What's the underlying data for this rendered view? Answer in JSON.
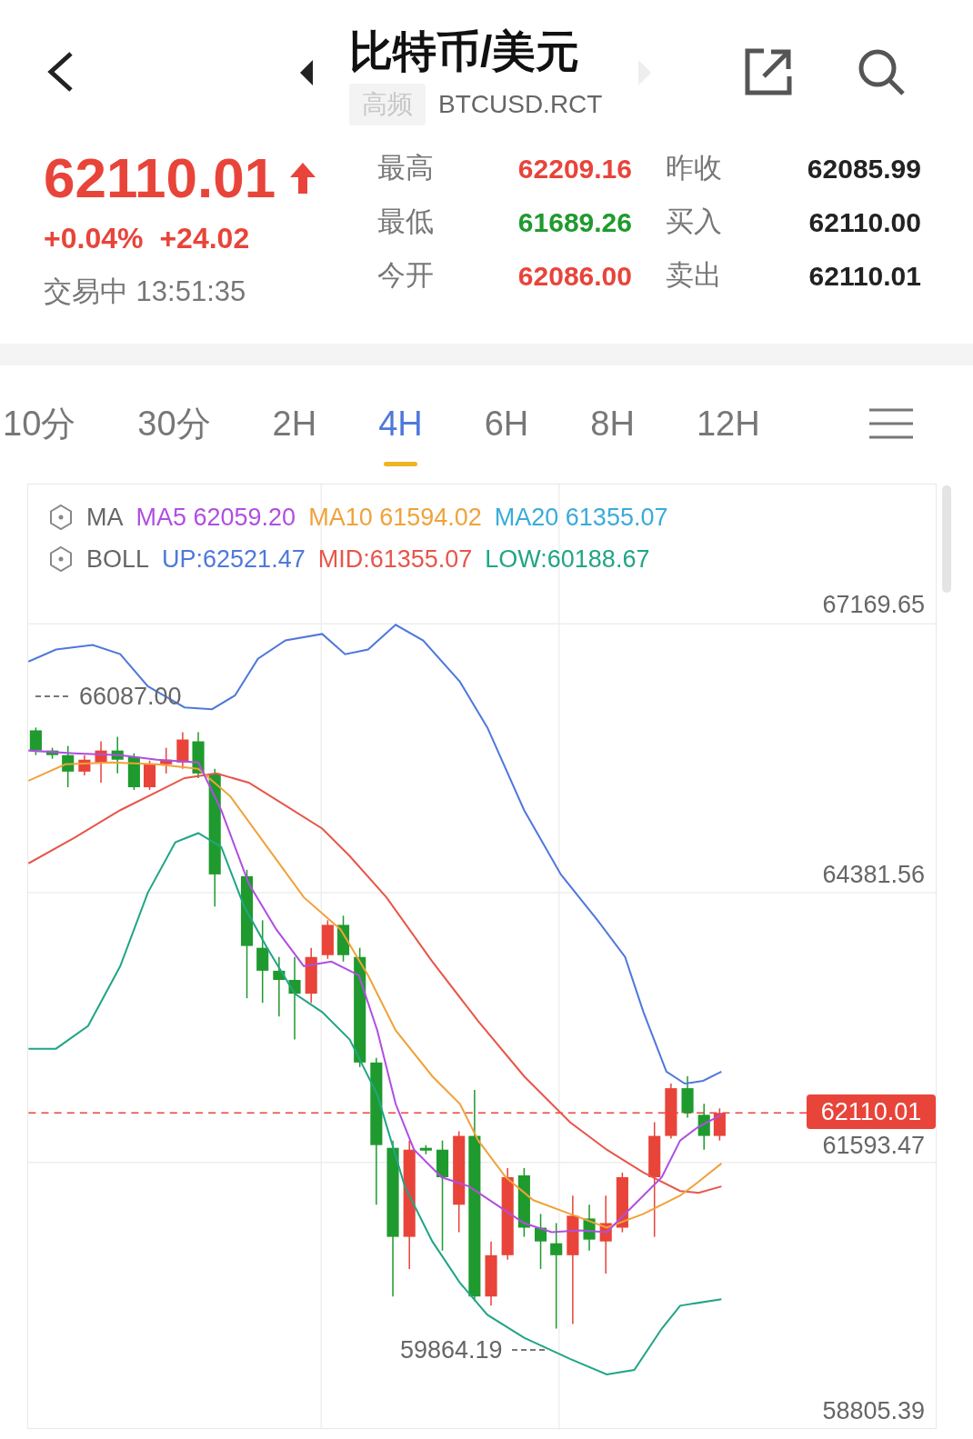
{
  "header": {
    "title": "比特币/美元",
    "badge": "高频",
    "symbol": "BTCUSD.RCT",
    "prev_disabled": false,
    "next_disabled": true
  },
  "quote": {
    "price": "62110.01",
    "rising": true,
    "change_pct": "+0.04%",
    "change": "+24.02",
    "status": "交易中 13:51:35",
    "stats": [
      {
        "label": "最高",
        "value": "62209.16",
        "color": "#e8443a"
      },
      {
        "label": "昨收",
        "value": "62085.99",
        "color": "#222222"
      },
      {
        "label": "最低",
        "value": "61689.26",
        "color": "#1f9a2e"
      },
      {
        "label": "买入",
        "value": "62110.00",
        "color": "#222222"
      },
      {
        "label": "今开",
        "value": "62086.00",
        "color": "#e8443a"
      },
      {
        "label": "卖出",
        "value": "62110.01",
        "color": "#222222"
      }
    ]
  },
  "tabs": [
    {
      "label": "10分",
      "selected": false
    },
    {
      "label": "30分",
      "selected": false
    },
    {
      "label": "2H",
      "selected": false
    },
    {
      "label": "4H",
      "selected": true
    },
    {
      "label": "6H",
      "selected": false
    },
    {
      "label": "8H",
      "selected": false
    },
    {
      "label": "12H",
      "selected": false
    }
  ],
  "indicators": [
    {
      "name": "MA",
      "values": [
        {
          "text": "MA5 62059.20",
          "color": "#b04fe0"
        },
        {
          "text": "MA10 61594.02",
          "color": "#f0a23a"
        },
        {
          "text": "MA20 61355.07",
          "color": "#3aabd9"
        }
      ]
    },
    {
      "name": "BOLL",
      "values": [
        {
          "text": "UP:62521.47",
          "color": "#4f78db"
        },
        {
          "text": "MID:61355.07",
          "color": "#e8554a"
        },
        {
          "text": "LOW:60188.67",
          "color": "#21a586"
        }
      ]
    }
  ],
  "chart": {
    "y_labels": [
      "67169.65",
      "64381.56",
      "61593.47",
      "58805.39"
    ],
    "high_marker": "66087.00",
    "low_marker": "59864.19",
    "last_price": "62110.01"
  }
}
